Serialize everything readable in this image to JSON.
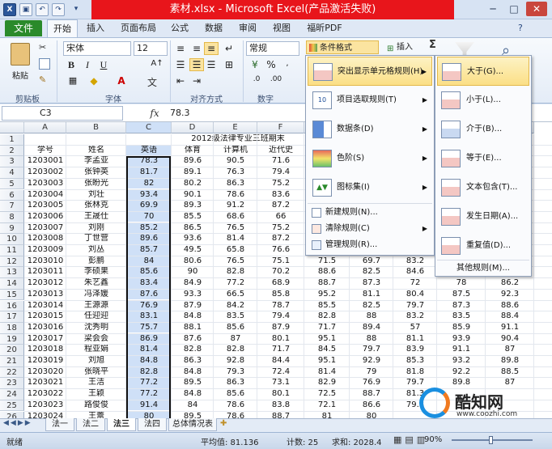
{
  "window": {
    "title": "素材.xlsx - Microsoft Excel(产品激活失败)",
    "controls": [
      "─",
      "□",
      "✕"
    ]
  },
  "quick_access": [
    "save-icon",
    "undo-icon",
    "redo-icon"
  ],
  "tabs": [
    "文件",
    "开始",
    "插入",
    "页面布局",
    "公式",
    "数据",
    "审阅",
    "视图",
    "福昕PDF"
  ],
  "ribbon": {
    "paste_label": "粘贴",
    "font_name": "宋体",
    "font_size": "12",
    "number_format": "常规",
    "conditional_format_label": "条件格式",
    "insert_label": "插入",
    "sigma": "Σ",
    "sort_filter_icon": "sort-filter-icon",
    "find_icon": "find-icon",
    "bold": "B",
    "italic": "I",
    "underline": "U",
    "wen": "文",
    "percent": "%",
    "groups": [
      "剪贴板",
      "字体",
      "对齐方式",
      "数字"
    ]
  },
  "formula_bar": {
    "cell_ref": "C3",
    "fx": "fx",
    "value": "78.3"
  },
  "sheet": {
    "columns": [
      "A",
      "B",
      "C",
      "D",
      "E",
      "F",
      "G",
      "H",
      "I",
      "J",
      "K"
    ],
    "title_text": "2012级法律专业三班期末",
    "headers": [
      "学号",
      "姓名",
      "英语",
      "体育",
      "计算机",
      "近代史"
    ],
    "rows": [
      {
        "r": "3",
        "id": "1203001",
        "name": "李孟亚",
        "c": "78.3",
        "d": "89.6",
        "e": "90.5",
        "f": "71.6",
        "g": "",
        "h": "",
        "i": "",
        "j": "",
        "k": ""
      },
      {
        "r": "4",
        "id": "1203002",
        "name": "张钟英",
        "c": "81.7",
        "d": "89.1",
        "e": "76.3",
        "f": "79.4",
        "g": "",
        "h": "",
        "i": "",
        "j": "",
        "k": ""
      },
      {
        "r": "5",
        "id": "1203003",
        "name": "张盼光",
        "c": "82",
        "d": "80.2",
        "e": "86.3",
        "f": "75.2",
        "g": "",
        "h": "",
        "i": "",
        "j": "",
        "k": ""
      },
      {
        "r": "6",
        "id": "1203004",
        "name": "刘壮",
        "c": "93.4",
        "d": "90.1",
        "e": "78.6",
        "f": "83.6",
        "g": "",
        "h": "",
        "i": "",
        "j": "",
        "k": ""
      },
      {
        "r": "7",
        "id": "1203005",
        "name": "张林克",
        "c": "69.9",
        "d": "89.3",
        "e": "91.2",
        "f": "87.2",
        "g": "",
        "h": "",
        "i": "",
        "j": "",
        "k": ""
      },
      {
        "r": "8",
        "id": "1203006",
        "name": "王晟仕",
        "c": "70",
        "d": "85.5",
        "e": "68.6",
        "f": "66",
        "g": "",
        "h": "",
        "i": "",
        "j": "",
        "k": ""
      },
      {
        "r": "9",
        "id": "1203007",
        "name": "刘刚",
        "c": "85.2",
        "d": "86.5",
        "e": "76.5",
        "f": "75.2",
        "g": "",
        "h": "",
        "i": "",
        "j": "",
        "k": ""
      },
      {
        "r": "10",
        "id": "1203008",
        "name": "丁世营",
        "c": "89.6",
        "d": "93.6",
        "e": "81.4",
        "f": "87.2",
        "g": "",
        "h": "",
        "i": "",
        "j": "",
        "k": ""
      },
      {
        "r": "11",
        "id": "1203009",
        "name": "刘丛",
        "c": "85.7",
        "d": "49.5",
        "e": "65.8",
        "f": "76.6",
        "g": "",
        "h": "",
        "i": "",
        "j": "",
        "k": ""
      },
      {
        "r": "12",
        "id": "1203010",
        "name": "彭鹏",
        "c": "84",
        "d": "80.6",
        "e": "76.5",
        "f": "75.1",
        "g": "71.5",
        "h": "69.7",
        "i": "83.2",
        "j": "",
        "k": ""
      },
      {
        "r": "13",
        "id": "1203011",
        "name": "李硕果",
        "c": "85.6",
        "d": "90",
        "e": "82.8",
        "f": "70.2",
        "g": "88.6",
        "h": "82.5",
        "i": "84.6",
        "j": "",
        "k": ""
      },
      {
        "r": "14",
        "id": "1203012",
        "name": "朱艺鑫",
        "c": "83.4",
        "d": "84.9",
        "e": "77.2",
        "f": "68.9",
        "g": "88.7",
        "h": "87.3",
        "i": "72",
        "j": "78",
        "k": "86.2"
      },
      {
        "r": "15",
        "id": "1203013",
        "name": "冯泽媛",
        "c": "87.6",
        "d": "93.3",
        "e": "66.5",
        "f": "85.8",
        "g": "95.2",
        "h": "81.1",
        "i": "80.4",
        "j": "87.5",
        "k": "92.3"
      },
      {
        "r": "16",
        "id": "1203014",
        "name": "王源源",
        "c": "76.9",
        "d": "87.9",
        "e": "84.2",
        "f": "78.7",
        "g": "85.5",
        "h": "82.5",
        "i": "79.7",
        "j": "87.3",
        "k": "88.6"
      },
      {
        "r": "17",
        "id": "1203015",
        "name": "任迎迎",
        "c": "83.1",
        "d": "84.8",
        "e": "83.5",
        "f": "79.4",
        "g": "82.8",
        "h": "88",
        "i": "83.2",
        "j": "83.5",
        "k": "88.4"
      },
      {
        "r": "18",
        "id": "1203016",
        "name": "沈秀明",
        "c": "75.7",
        "d": "88.1",
        "e": "85.6",
        "f": "87.9",
        "g": "71.7",
        "h": "89.4",
        "i": "57",
        "j": "85.9",
        "k": "91.1"
      },
      {
        "r": "19",
        "id": "1203017",
        "name": "梁会会",
        "c": "86.9",
        "d": "87.6",
        "e": "87",
        "f": "80.1",
        "g": "95.1",
        "h": "88",
        "i": "81.1",
        "j": "93.9",
        "k": "90.4"
      },
      {
        "r": "20",
        "id": "1203018",
        "name": "程亚娟",
        "c": "81.4",
        "d": "82.8",
        "e": "82.8",
        "f": "71.7",
        "g": "84.5",
        "h": "79.7",
        "i": "83.9",
        "j": "91.1",
        "k": "87"
      },
      {
        "r": "21",
        "id": "1203019",
        "name": "刘旭",
        "c": "84.8",
        "d": "86.3",
        "e": "92.8",
        "f": "84.4",
        "g": "95.1",
        "h": "92.9",
        "i": "85.3",
        "j": "93.2",
        "k": "89.8"
      },
      {
        "r": "22",
        "id": "1203020",
        "name": "张晓平",
        "c": "82.8",
        "d": "84.8",
        "e": "79.3",
        "f": "72.4",
        "g": "81.4",
        "h": "79",
        "i": "81.8",
        "j": "92.2",
        "k": "88.5"
      },
      {
        "r": "23",
        "id": "1203021",
        "name": "王洁",
        "c": "77.2",
        "d": "89.5",
        "e": "86.3",
        "f": "73.1",
        "g": "82.9",
        "h": "76.9",
        "i": "79.7",
        "j": "89.8",
        "k": "87"
      },
      {
        "r": "24",
        "id": "1203022",
        "name": "王颖",
        "c": "77.2",
        "d": "84.8",
        "e": "85.6",
        "f": "80.1",
        "g": "72.5",
        "h": "88.7",
        "i": "81.3",
        "j": "",
        "k": ""
      },
      {
        "r": "25",
        "id": "1203023",
        "name": "路俊俊",
        "c": "91.4",
        "d": "84",
        "e": "78.6",
        "f": "83.8",
        "g": "72.1",
        "h": "86.6",
        "i": "79.3",
        "j": "",
        "k": ""
      },
      {
        "r": "26",
        "id": "1203024",
        "name": "王蕾",
        "c": "80",
        "d": "89.5",
        "e": "78.6",
        "f": "88.7",
        "g": "81",
        "h": "80",
        "i": "",
        "j": "",
        "k": ""
      }
    ]
  },
  "sheet_tabs": [
    "法一",
    "法二",
    "法三",
    "法四",
    "总体情况表"
  ],
  "status": {
    "ready": "就绪",
    "average": "平均值: 81.136",
    "count": "计数: 25",
    "sum": "求和: 2028.4",
    "zoom": "90%"
  },
  "cf_menu": {
    "items": [
      "突出显示单元格规则(H)",
      "项目选取规则(T)",
      "数据条(D)",
      "色阶(S)",
      "图标集(I)"
    ],
    "small_items": [
      "新建规则(N)...",
      "清除规则(C)",
      "管理规则(R)..."
    ]
  },
  "highlight_submenu": {
    "items": [
      "大于(G)...",
      "小于(L)...",
      "介于(B)...",
      "等于(E)...",
      "文本包含(T)...",
      "发生日期(A)...",
      "重复值(D)..."
    ],
    "more": "其他规则(M)..."
  },
  "watermark": {
    "brand": "酷知网",
    "url": "www.coozhi.com"
  }
}
